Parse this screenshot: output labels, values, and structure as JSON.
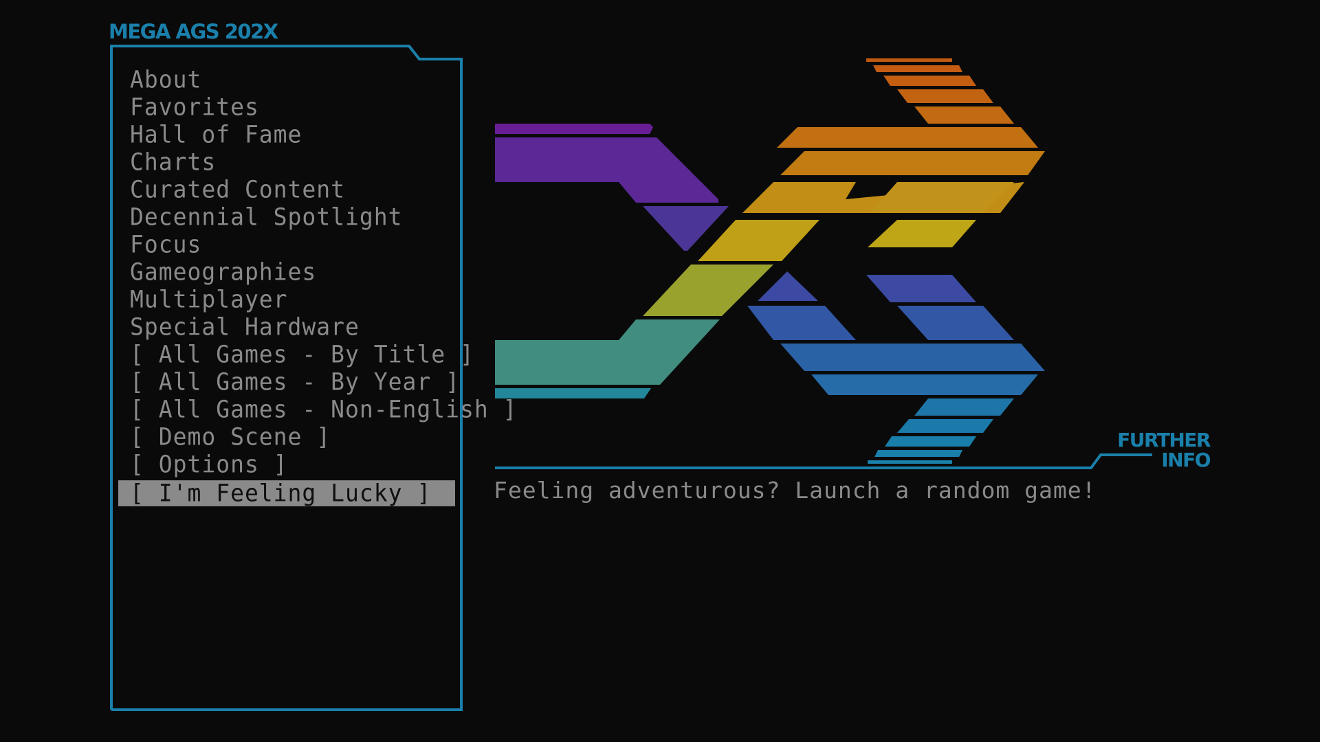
{
  "app": {
    "title": "MEGA AGS 202X"
  },
  "menu": {
    "items": [
      {
        "label": "About",
        "selected": false
      },
      {
        "label": "Favorites",
        "selected": false
      },
      {
        "label": "Hall of Fame",
        "selected": false
      },
      {
        "label": "Charts",
        "selected": false
      },
      {
        "label": "Curated Content",
        "selected": false
      },
      {
        "label": "Decennial Spotlight",
        "selected": false
      },
      {
        "label": "Focus",
        "selected": false
      },
      {
        "label": "Gameographies",
        "selected": false
      },
      {
        "label": "Multiplayer",
        "selected": false
      },
      {
        "label": "Special Hardware",
        "selected": false
      },
      {
        "label": "[ All Games - By Title ]",
        "selected": false
      },
      {
        "label": "[ All Games - By Year ]",
        "selected": false
      },
      {
        "label": "[ All Games - Non-English ]",
        "selected": false
      },
      {
        "label": "[ Demo Scene ]",
        "selected": false
      },
      {
        "label": "[ Options ]",
        "selected": false
      },
      {
        "label": "[ I'm Feeling Lucky ]",
        "selected": true
      }
    ]
  },
  "info": {
    "further_info_line1": "FURTHER",
    "further_info_line2": "INFO",
    "description": "Feeling adventurous? Launch a random game!"
  },
  "theme": {
    "accent": "#1a80ab",
    "text": "#8a8a8a",
    "background": "#0a0a0a",
    "selection_bg": "#8a8a8a",
    "selection_text": "#0f0f0f"
  },
  "logo": {
    "icon": "mega-ags-logo-icon"
  }
}
